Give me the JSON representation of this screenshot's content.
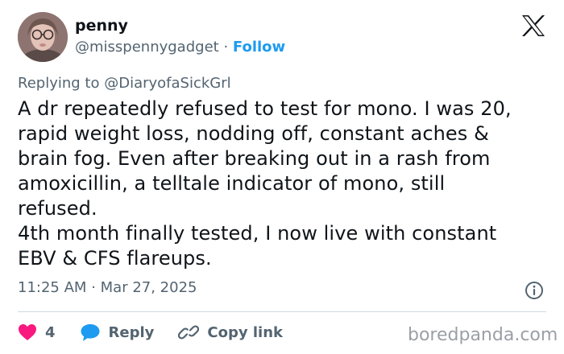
{
  "author": {
    "name": "penny",
    "handle": "@misspennygadget",
    "separator": "·",
    "follow_label": "Follow"
  },
  "reply_context": {
    "prefix": "Replying to",
    "mention": "@DiaryofaSickGrl"
  },
  "tweet": {
    "text": "A dr repeatedly refused to test for mono. I was 20,\nrapid weight loss, nodding off, constant aches &\nbrain fog. Even after breaking out in a rash from\namoxicillin, a telltale indicator of mono, still\nrefused.\n4th month finally tested, I now live with constant\nEBV & CFS flareups.",
    "time": "11:25 AM",
    "date": "Mar 27, 2025",
    "time_separator": "·"
  },
  "actions": {
    "like_count": "4",
    "reply_label": "Reply",
    "copy_link_label": "Copy link"
  },
  "watermark": "boredpanda.com",
  "colors": {
    "like": "#f91880",
    "reply": "#1d9bf0",
    "follow": "#1d9bf0",
    "secondary_text": "#536471"
  },
  "icons": [
    "x-logo-icon",
    "info-icon",
    "heart-icon",
    "reply-bubble-icon",
    "link-icon"
  ]
}
